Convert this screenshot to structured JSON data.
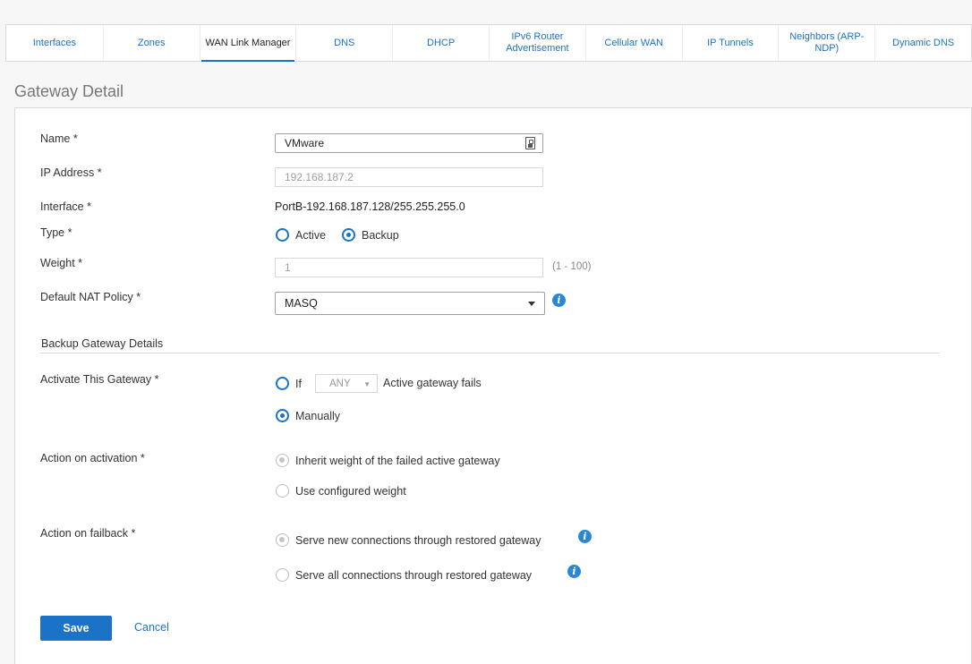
{
  "tabs": [
    {
      "label": "Interfaces"
    },
    {
      "label": "Zones"
    },
    {
      "label": "WAN Link Manager"
    },
    {
      "label": "DNS"
    },
    {
      "label": "DHCP"
    },
    {
      "label": "IPv6 Router Advertisement"
    },
    {
      "label": "Cellular WAN"
    },
    {
      "label": "IP Tunnels"
    },
    {
      "label": "Neighbors (ARP-NDP)"
    },
    {
      "label": "Dynamic DNS"
    }
  ],
  "page_title": "Gateway Detail",
  "form": {
    "name": {
      "label": "Name *",
      "value": "VMware"
    },
    "ip": {
      "label": "IP Address *",
      "value": "192.168.187.2"
    },
    "interface": {
      "label": "Interface *",
      "value": "PortB-192.168.187.128/255.255.255.0"
    },
    "type": {
      "label": "Type *",
      "active": "Active",
      "backup": "Backup"
    },
    "weight": {
      "label": "Weight *",
      "value": "1",
      "range": "(1 - 100)"
    },
    "nat": {
      "label": "Default NAT Policy *",
      "value": "MASQ"
    }
  },
  "backup": {
    "section_title": "Backup Gateway Details",
    "activate": {
      "label": "Activate This Gateway *",
      "if_label": "If",
      "any_value": "ANY",
      "fails_text": "Active gateway fails",
      "manually": "Manually"
    },
    "action_activation": {
      "label": "Action on activation *",
      "inherit": "Inherit weight of the failed active gateway",
      "configured": "Use configured weight"
    },
    "action_failback": {
      "label": "Action on failback *",
      "new_conn": "Serve new connections through restored gateway",
      "all_conn": "Serve all connections through restored gateway"
    }
  },
  "buttons": {
    "save": "Save",
    "cancel": "Cancel"
  },
  "colors": {
    "accent": "#1a73c7",
    "info": "#2d86d1"
  }
}
